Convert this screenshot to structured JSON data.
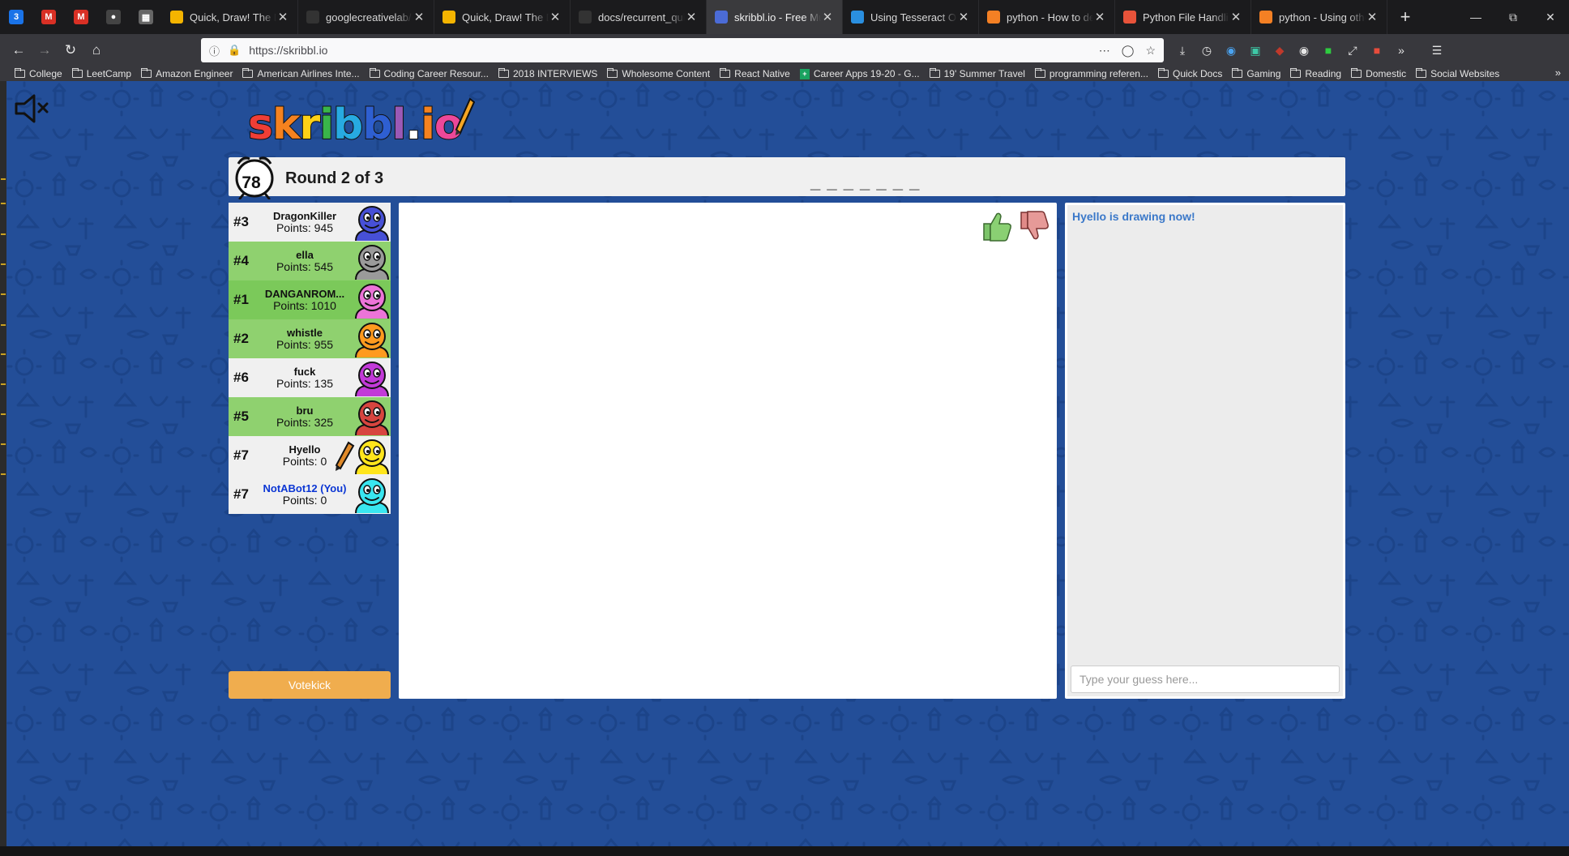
{
  "browser": {
    "pinned_tabs": [
      {
        "icon": "calendar-icon",
        "label": "3",
        "color": "#1a73e8"
      },
      {
        "icon": "gmail-icon",
        "label": "M",
        "color": "#d93025"
      },
      {
        "icon": "gmail-icon",
        "label": "M",
        "color": "#d93025"
      },
      {
        "icon": "chat-icon",
        "label": "●",
        "color": "#444"
      },
      {
        "icon": "qr-icon",
        "label": "▦",
        "color": "#666"
      }
    ],
    "tabs": [
      {
        "title": "Quick, Draw! The Da",
        "icon": "quickdraw-icon",
        "color": "#f4b400",
        "active": false
      },
      {
        "title": "googlecreativelab/q",
        "icon": "github-icon",
        "color": "#333",
        "active": false
      },
      {
        "title": "Quick, Draw! The Da",
        "icon": "quickdraw-icon",
        "color": "#f4b400",
        "active": false
      },
      {
        "title": "docs/recurrent_qui",
        "icon": "github-icon",
        "color": "#333",
        "active": false
      },
      {
        "title": "skribbl.io - Free Mul",
        "icon": "skribbl-icon",
        "color": "#4b6bd6",
        "active": true
      },
      {
        "title": "Using Tesseract OCR",
        "icon": "pyimagesearch-icon",
        "color": "#2a8fe0",
        "active": false
      },
      {
        "title": "python - How to de",
        "icon": "stackoverflow-icon",
        "color": "#f48024",
        "active": false
      },
      {
        "title": "Python File Handlin",
        "icon": "geeks-icon",
        "color": "#e8533a",
        "active": false
      },
      {
        "title": "python - Using othe",
        "icon": "stackoverflow-icon",
        "color": "#f48024",
        "active": false
      }
    ],
    "new_tab": "+",
    "url": "https://skribbl.io",
    "bookmarks": [
      {
        "label": "College",
        "type": "folder"
      },
      {
        "label": "LeetCamp",
        "type": "folder"
      },
      {
        "label": "Amazon Engineer",
        "type": "folder"
      },
      {
        "label": "American Airlines Inte...",
        "type": "folder"
      },
      {
        "label": "Coding Career Resour...",
        "type": "folder"
      },
      {
        "label": "2018 INTERVIEWS",
        "type": "folder"
      },
      {
        "label": "Wholesome Content",
        "type": "folder"
      },
      {
        "label": "React Native",
        "type": "folder"
      },
      {
        "label": "Career Apps 19-20 - G...",
        "type": "sheet"
      },
      {
        "label": "19' Summer Travel",
        "type": "folder"
      },
      {
        "label": "programming referen...",
        "type": "folder"
      },
      {
        "label": "Quick Docs",
        "type": "folder"
      },
      {
        "label": "Gaming",
        "type": "folder"
      },
      {
        "label": "Reading",
        "type": "folder"
      },
      {
        "label": "Domestic",
        "type": "folder"
      },
      {
        "label": "Social Websites",
        "type": "folder"
      }
    ],
    "bookmarks_more": "»"
  },
  "game": {
    "logo_letters": [
      {
        "ch": "s",
        "color": "#ef3e36"
      },
      {
        "ch": "k",
        "color": "#f5821f"
      },
      {
        "ch": "r",
        "color": "#fcd116"
      },
      {
        "ch": "i",
        "color": "#39b54a"
      },
      {
        "ch": "b",
        "color": "#27aae1"
      },
      {
        "ch": "b",
        "color": "#2e5fd1"
      },
      {
        "ch": "l",
        "color": "#9b59b6"
      },
      {
        "ch": ".",
        "color": "#ffffff"
      },
      {
        "ch": "i",
        "color": "#f5821f"
      },
      {
        "ch": "o",
        "color": "#ec4899"
      }
    ],
    "timer": "78",
    "round_text": "Round 2 of 3",
    "word_hint": "_ _ _ _ _ _ _",
    "players": [
      {
        "rank": "#3",
        "name": "DragonKiller",
        "points": "Points: 945",
        "bg": "light",
        "avatar_color": "#4750d6",
        "you": false,
        "drawing": false
      },
      {
        "rank": "#4",
        "name": "ella",
        "points": "Points: 545",
        "bg": "green",
        "avatar_color": "#9a9a9a",
        "you": false,
        "drawing": false
      },
      {
        "rank": "#1",
        "name": "DANGANROM...",
        "points": "Points: 1010",
        "bg": "green2",
        "avatar_color": "#ec74d8",
        "you": false,
        "drawing": false
      },
      {
        "rank": "#2",
        "name": "whistle",
        "points": "Points: 955",
        "bg": "green",
        "avatar_color": "#ff9a1f",
        "you": false,
        "drawing": false
      },
      {
        "rank": "#6",
        "name": "fuck",
        "points": "Points: 135",
        "bg": "light",
        "avatar_color": "#c23ad8",
        "you": false,
        "drawing": false
      },
      {
        "rank": "#5",
        "name": "bru",
        "points": "Points: 325",
        "bg": "green",
        "avatar_color": "#d7453f",
        "you": false,
        "drawing": false
      },
      {
        "rank": "#7",
        "name": "Hyello",
        "points": "Points: 0",
        "bg": "light",
        "avatar_color": "#ffe51c",
        "you": false,
        "drawing": true
      },
      {
        "rank": "#7",
        "name": "NotABot12 (You)",
        "points": "Points: 0",
        "bg": "light",
        "avatar_color": "#39e6f0",
        "you": true,
        "drawing": false
      }
    ],
    "votekick_label": "Votekick",
    "chat_messages": [
      "Hyello is drawing now!"
    ],
    "guess_placeholder": "Type your guess here...",
    "colors": {
      "page_bg": "#234e98",
      "votekick": "#f0ad4e",
      "chat_system": "#3a78c9"
    }
  }
}
